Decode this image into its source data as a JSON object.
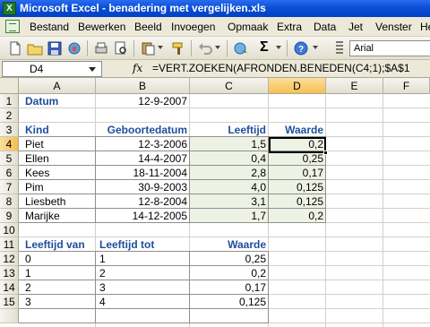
{
  "window": {
    "title": "Microsoft Excel - benadering met vergelijken.xls"
  },
  "menu": [
    "Bestand",
    "Bewerken",
    "Beeld",
    "Invoegen",
    "Opmaak",
    "Extra",
    "Data",
    "Jet",
    "Venster",
    "He"
  ],
  "toolbar": {
    "font": "Arial",
    "zoom_icon_label": "Σ"
  },
  "formula_bar": {
    "cell_ref": "D4",
    "fx": "fx",
    "formula": "=VERT.ZOEKEN(AFRONDEN.BENEDEN(C4;1);$A$1"
  },
  "columns": [
    "A",
    "B",
    "C",
    "D",
    "E",
    "F"
  ],
  "rows": [
    "1",
    "2",
    "3",
    "4",
    "5",
    "6",
    "7",
    "8",
    "9",
    "10",
    "11",
    "12",
    "13",
    "14",
    "15"
  ],
  "sheet": {
    "datum_label": "Datum",
    "datum_value": "12-9-2007",
    "table1_headers": [
      "Kind",
      "Geboortedatum",
      "Leeftijd",
      "Waarde"
    ],
    "table1_rows": [
      [
        "Piet",
        "12-3-2006",
        "1,5",
        "0,2"
      ],
      [
        "Ellen",
        "14-4-2007",
        "0,4",
        "0,25"
      ],
      [
        "Kees",
        "18-11-2004",
        "2,8",
        "0,17"
      ],
      [
        "Pim",
        "30-9-2003",
        "4,0",
        "0,125"
      ],
      [
        "Liesbeth",
        "12-8-2004",
        "3,1",
        "0,125"
      ],
      [
        "Marijke",
        "14-12-2005",
        "1,7",
        "0,2"
      ]
    ],
    "table2_headers": [
      "Leeftijd van",
      "Leeftijd tot",
      "Waarde"
    ],
    "table2_rows": [
      [
        "0",
        "1",
        "0,25"
      ],
      [
        "1",
        "2",
        "0,2"
      ],
      [
        "2",
        "3",
        "0,17"
      ],
      [
        "3",
        "4",
        "0,125"
      ]
    ]
  }
}
